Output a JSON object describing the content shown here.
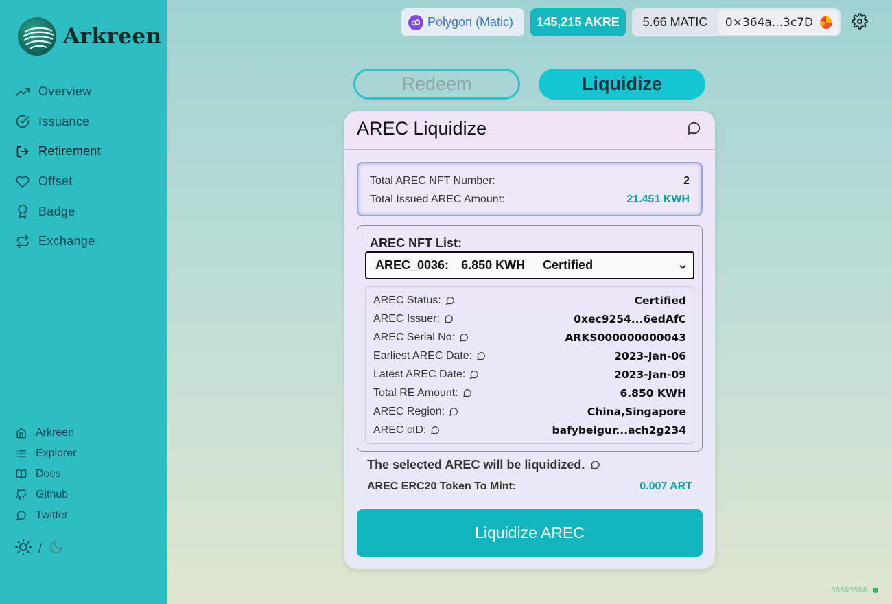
{
  "brand": {
    "name": "Arkreen"
  },
  "sidebar": {
    "nav": [
      {
        "label": "Overview",
        "icon": "trending-up-icon"
      },
      {
        "label": "Issuance",
        "icon": "check-circle-icon"
      },
      {
        "label": "Retirement",
        "icon": "log-out-icon",
        "active": true
      },
      {
        "label": "Offset",
        "icon": "heart-icon"
      },
      {
        "label": "Badge",
        "icon": "award-icon"
      },
      {
        "label": "Exchange",
        "icon": "repeat-icon"
      }
    ],
    "links": [
      {
        "label": "Arkreen",
        "icon": "home-icon"
      },
      {
        "label": "Explorer",
        "icon": "list-icon"
      },
      {
        "label": "Docs",
        "icon": "book-icon"
      },
      {
        "label": "Github",
        "icon": "github-icon"
      },
      {
        "label": "Twitter",
        "icon": "message-circle-icon"
      }
    ],
    "theme_separator": "/"
  },
  "header": {
    "network": "Polygon (Matic)",
    "akre_balance": "145,215  AKRE",
    "matic_balance": "5.66 MATIC",
    "address": "0×364a...3c7D"
  },
  "tabs": {
    "redeem": "Redeem",
    "liquidize": "Liquidize"
  },
  "card": {
    "title": "AREC Liquidize",
    "summary": {
      "nft_number_label": "Total AREC NFT Number:",
      "nft_number_value": "2",
      "issued_amount_label": "Total Issued AREC Amount:",
      "issued_amount_value": "21.451 KWH"
    },
    "list": {
      "title": "AREC NFT List:",
      "selected": {
        "id": "AREC_0036:",
        "amount": "6.850 KWH",
        "status": "Certified"
      },
      "details": [
        {
          "label": "AREC Status:",
          "value": "Certified"
        },
        {
          "label": "AREC Issuer:",
          "value": "0xec9254...6edAfC"
        },
        {
          "label": "AREC Serial No:",
          "value": "ARKS000000000043"
        },
        {
          "label": "Earliest AREC Date:",
          "value": "2023-Jan-06"
        },
        {
          "label": "Latest AREC Date:",
          "value": "2023-Jan-09"
        },
        {
          "label": "Total RE Amount:",
          "value": "6.850 KWH"
        },
        {
          "label": "AREC Region:",
          "value": "China,Singapore"
        },
        {
          "label": "AREC cID:",
          "value": "bafybeigur...ach2g234"
        }
      ]
    },
    "notice": "The selected AREC will be liquidized.",
    "mint_label": "AREC ERC20 Token To Mint:",
    "mint_value": "0.007 ART",
    "action_label": "Liquidize AREC"
  },
  "footer": {
    "block_number": "38503508"
  },
  "colors": {
    "accent": "#14c6d2",
    "sidebar": "#2ebdc2",
    "teal_text": "#169ea7",
    "status_dot": "#2bb55d"
  }
}
